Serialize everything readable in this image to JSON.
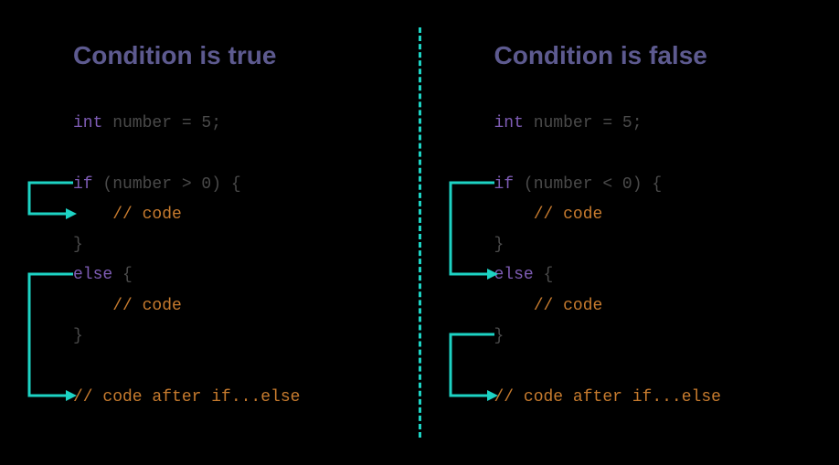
{
  "left": {
    "heading": "Condition is true",
    "code": {
      "decl_type": "int",
      "decl_rest": " number = 5;",
      "if_kw": "if",
      "if_cond": " (number > 0) {",
      "if_body": "    // code",
      "if_close": "}",
      "else_kw": "else",
      "else_open": " {",
      "else_body": "    // code",
      "else_close": "}",
      "after": "// code after if...else"
    }
  },
  "right": {
    "heading": "Condition is false",
    "code": {
      "decl_type": "int",
      "decl_rest": " number = 5;",
      "if_kw": "if",
      "if_cond": " (number < 0) {",
      "if_body": "    // code",
      "if_close": "}",
      "else_kw": "else",
      "else_open": " {",
      "else_body": "    // code",
      "else_close": "}",
      "after": "// code after if...else"
    }
  },
  "colors": {
    "background": "#000000",
    "heading": "#5d5a8f",
    "keyword": "#7e5cb5",
    "identifier": "#4a4a4a",
    "comment": "#c77b2e",
    "arrow": "#1dd3c4"
  }
}
